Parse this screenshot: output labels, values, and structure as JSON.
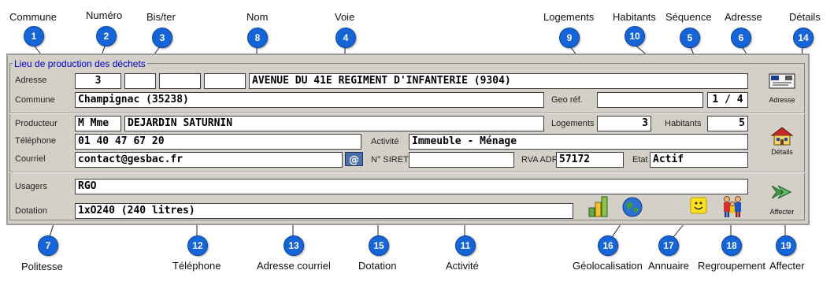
{
  "top_labels": {
    "commune": "Commune",
    "numero": "Numéro",
    "bister": "Bis/ter",
    "nom": "Nom",
    "voie": "Voie",
    "logements": "Logements",
    "habitants": "Habitants",
    "sequence": "Séquence",
    "adresse": "Adresse",
    "details": "Détails"
  },
  "bottom_labels": {
    "politesse": "Politesse",
    "telephone": "Téléphone",
    "adresse_courriel": "Adresse courriel",
    "dotation": "Dotation",
    "activite": "Activité",
    "geolocalisation": "Géolocalisation",
    "annuaire": "Annuaire",
    "regroupement": "Regroupement",
    "affecter": "Affecter"
  },
  "badges": {
    "b1": "1",
    "b2": "2",
    "b3": "3",
    "b4": "4",
    "b5": "5",
    "b6": "6",
    "b7": "7",
    "b8": "8",
    "b9": "9",
    "b10": "10",
    "b11": "11",
    "b12": "12",
    "b13": "13",
    "b14": "14",
    "b15": "15",
    "b16": "16",
    "b17": "17",
    "b18": "18",
    "b19": "19"
  },
  "form": {
    "title": "Lieu de production des déchets",
    "labels": {
      "adresse": "Adresse",
      "commune": "Commune",
      "geo_ref": "Geo réf.",
      "producteur": "Producteur",
      "logements": "Logements",
      "habitants": "Habitants",
      "telephone": "Téléphone",
      "activite": "Activité",
      "courriel": "Courriel",
      "siret": "N° SIRET",
      "rva_adr": "RVA ADR",
      "etat": "Etat",
      "usagers": "Usagers",
      "dotation": "Dotation"
    },
    "values": {
      "numero": "3",
      "bis": "",
      "extra1": "",
      "extra2": "",
      "voie": "AVENUE DU 41E REGIMENT D'INFANTERIE (9304)",
      "commune": "Champignac (35238)",
      "geo_ref": "",
      "sequence": "1 / 4",
      "politesse": "M Mme",
      "nom": "DEJARDIN SATURNIN",
      "logements": "3",
      "habitants": "5",
      "telephone": "01 40 47 67 20",
      "activite": "Immeuble - Ménage",
      "courriel": "contact@gesbac.fr",
      "siret": "",
      "rva_adr": "57172",
      "etat": "Actif",
      "usagers": "RGO",
      "dotation": "1xO240 (240 litres)"
    },
    "buttons": {
      "adresse": "Adresse",
      "details": "Détails",
      "affecter": "Affecter"
    }
  },
  "colors": {
    "badge": "#1565d8",
    "panel": "#d4d0c8",
    "title": "#0000cc"
  }
}
